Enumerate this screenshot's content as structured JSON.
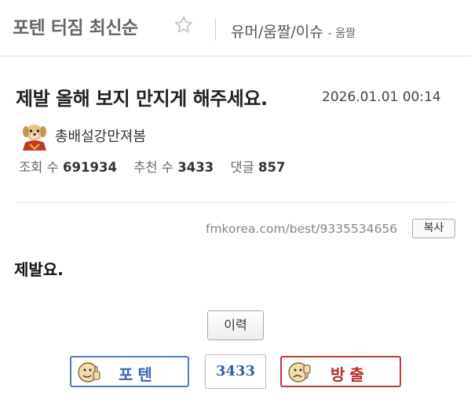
{
  "header": {
    "board_title": "포텐 터짐 최신순",
    "category": "유머/움짤/이슈",
    "category_sub": "- 움짤"
  },
  "post": {
    "title": "제발 올해 보지 만지게 해주세요.",
    "date": "2026.01.01 00:14",
    "author": "총배설강만져봄",
    "stats": {
      "views_label": "조회 수",
      "views": "691934",
      "recommends_label": "추천 수",
      "recommends": "3433",
      "comments_label": "댓글",
      "comments": "857"
    },
    "url": "fmkorea.com/best/9335534656",
    "copy_label": "복사",
    "content": "제발요."
  },
  "actions": {
    "history_label": "이력",
    "upvote_label": "포텐",
    "downvote_label": "방출",
    "vote_count": "3433"
  },
  "colors": {
    "upvote_border": "#4d79c7",
    "downvote_border": "#c43a3a",
    "count_text": "#2f5f9f"
  },
  "icons": {
    "favorite": "star-outline-icon",
    "avatar": "puppy-avatar",
    "upvote": "thumbs-up-face-icon",
    "downvote": "thumbs-down-face-icon"
  }
}
